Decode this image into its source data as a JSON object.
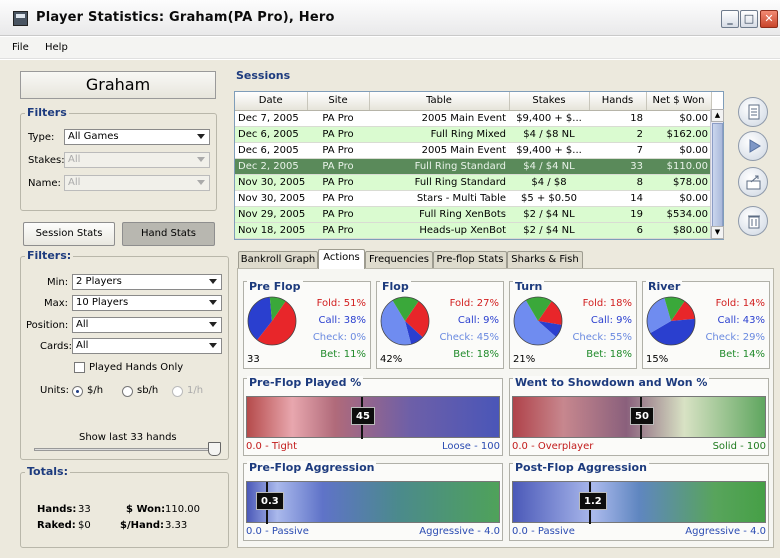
{
  "window": {
    "title": "Player Statistics: Graham(PA Pro), Hero",
    "min_glyph": "_",
    "max_glyph": "□",
    "close_glyph": "✕"
  },
  "menu": [
    "File",
    "Help"
  ],
  "player_name": "Graham",
  "filters_top": {
    "title": "Filters",
    "type_label": "Type:",
    "type_value": "All Games",
    "stakes_label": "Stakes:",
    "stakes_value": "All",
    "name_label": "Name:",
    "name_value": "All"
  },
  "view_buttons": {
    "session": "Session Stats",
    "hand": "Hand Stats"
  },
  "filters": {
    "title": "Filters:",
    "min_label": "Min:",
    "min_value": "2 Players",
    "max_label": "Max:",
    "max_value": "10 Players",
    "position_label": "Position:",
    "position_value": "All",
    "cards_label": "Cards:",
    "cards_value": "All",
    "played_only_label": "Played Hands Only",
    "units_label": "Units:",
    "units_options": [
      "$/h",
      "sb/h",
      "1/h"
    ],
    "units_selected": "$/h",
    "slider_label": "Show last 33 hands"
  },
  "totals": {
    "title": "Totals:",
    "hands_label": "Hands:",
    "hands_value": "33",
    "won_label": "$ Won:",
    "won_value": "110.00",
    "raked_label": "Raked:",
    "raked_value": "$0",
    "per_hand_label": "$/Hand:",
    "per_hand_value": "3.33"
  },
  "sessions": {
    "title": "Sessions",
    "columns": [
      "Date",
      "Site",
      "Table",
      "Stakes",
      "Hands",
      "Net $ Won"
    ],
    "rows": [
      [
        "Dec 7, 2005",
        "PA Pro",
        "2005 Main Event",
        "$9,400 + $...",
        "18",
        "$0.00"
      ],
      [
        "Dec 6, 2005",
        "PA Pro",
        "Full Ring Mixed",
        "$4 / $8 NL",
        "2",
        "$162.00"
      ],
      [
        "Dec 6, 2005",
        "PA Pro",
        "2005 Main Event",
        "$9,400 + $...",
        "7",
        "$0.00"
      ],
      [
        "Dec 2, 2005",
        "PA Pro",
        "Full Ring Standard",
        "$4 / $4 NL",
        "33",
        "$110.00"
      ],
      [
        "Nov 30, 2005",
        "PA Pro",
        "Full Ring Standard",
        "$4 / $8",
        "8",
        "$78.00"
      ],
      [
        "Nov 30, 2005",
        "PA Pro",
        "Stars - Multi Table",
        "$5 + $0.50",
        "14",
        "$0.00"
      ],
      [
        "Nov 29, 2005",
        "PA Pro",
        "Full Ring XenBots",
        "$2 / $4 NL",
        "19",
        "$534.00"
      ],
      [
        "Nov 18, 2005",
        "PA Pro",
        "Heads-up XenBot",
        "$2 / $4 NL",
        "6",
        "$80.00"
      ]
    ],
    "row_styles": [
      "white",
      "green",
      "white",
      "sel",
      "green",
      "white",
      "green",
      "green"
    ]
  },
  "tabs": [
    "Bankroll Graph",
    "Actions",
    "Frequencies",
    "Pre-flop Stats",
    "Sharks & Fish"
  ],
  "active_tab": "Actions",
  "streets": [
    {
      "name": "Pre Flop",
      "fold": "Fold: 51%",
      "call": "Call: 38%",
      "check": "Check: 0%",
      "bet": "Bet: 11%",
      "count": "33",
      "pie": [
        51,
        38,
        0,
        11
      ]
    },
    {
      "name": "Flop",
      "fold": "Fold: 27%",
      "call": "Call: 9%",
      "check": "Check: 45%",
      "bet": "Bet: 18%",
      "count": "42%",
      "pie": [
        27,
        9,
        45,
        18
      ]
    },
    {
      "name": "Turn",
      "fold": "Fold: 18%",
      "call": "Call: 9%",
      "check": "Check: 55%",
      "bet": "Bet: 18%",
      "count": "21%",
      "pie": [
        18,
        9,
        55,
        18
      ]
    },
    {
      "name": "River",
      "fold": "Fold: 14%",
      "call": "Call: 43%",
      "check": "Check: 29%",
      "bet": "Bet: 14%",
      "count": "15%",
      "pie": [
        14,
        43,
        29,
        14
      ]
    }
  ],
  "colors": {
    "fold": "#e8262a",
    "call": "#2a3fcf",
    "check": "#6f8cf0",
    "bet": "#3aa83a"
  },
  "gauges": [
    {
      "title": "Pre-Flop Played %",
      "value": "45",
      "level": 0.45,
      "left_label": "0.0 - Tight",
      "right_label": "Loose - 100"
    },
    {
      "title": "Went to Showdown and Won %",
      "value": "50",
      "level": 0.5,
      "left_label": "0.0 - Overplayer",
      "right_label": "Solid - 100"
    },
    {
      "title": "Pre-Flop Aggression",
      "value": "0.3",
      "level": 0.075,
      "left_label": "0.0 - Passive",
      "right_label": "Aggressive - 4.0"
    },
    {
      "title": "Post-Flop Aggression",
      "value": "1.2",
      "level": 0.3,
      "left_label": "0.0 - Passive",
      "right_label": "Aggressive - 4.0"
    }
  ]
}
